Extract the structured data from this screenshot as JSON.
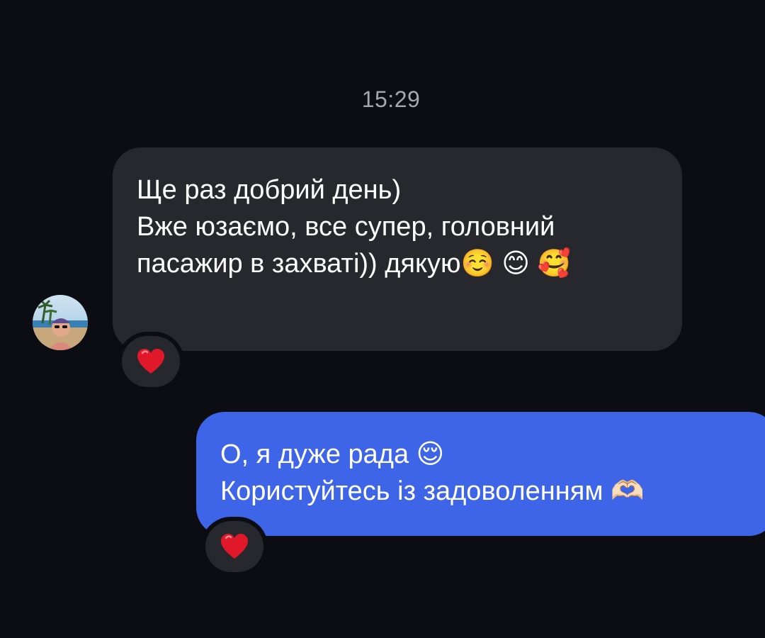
{
  "timestamp": "15:29",
  "incoming": {
    "lines": [
      "Ще раз добрий день)",
      "Вже юзаємо, все супер, головний пасажир в захваті)) дякую☺️ 😊 🥰"
    ],
    "reaction": "❤️"
  },
  "outgoing": {
    "lines": [
      "О, я дуже рада 😌",
      "Користуйтесь із задоволенням 🫶🏻"
    ],
    "reaction": "❤️"
  },
  "colors": {
    "background": "#0b0d13",
    "incoming_bubble": "#27282d",
    "outgoing_bubble": "#3e64e8",
    "timestamp_text": "#a4a7ae"
  },
  "icons": {
    "reaction_icon": "red-heart-icon",
    "avatar": "contact-avatar-photo"
  }
}
